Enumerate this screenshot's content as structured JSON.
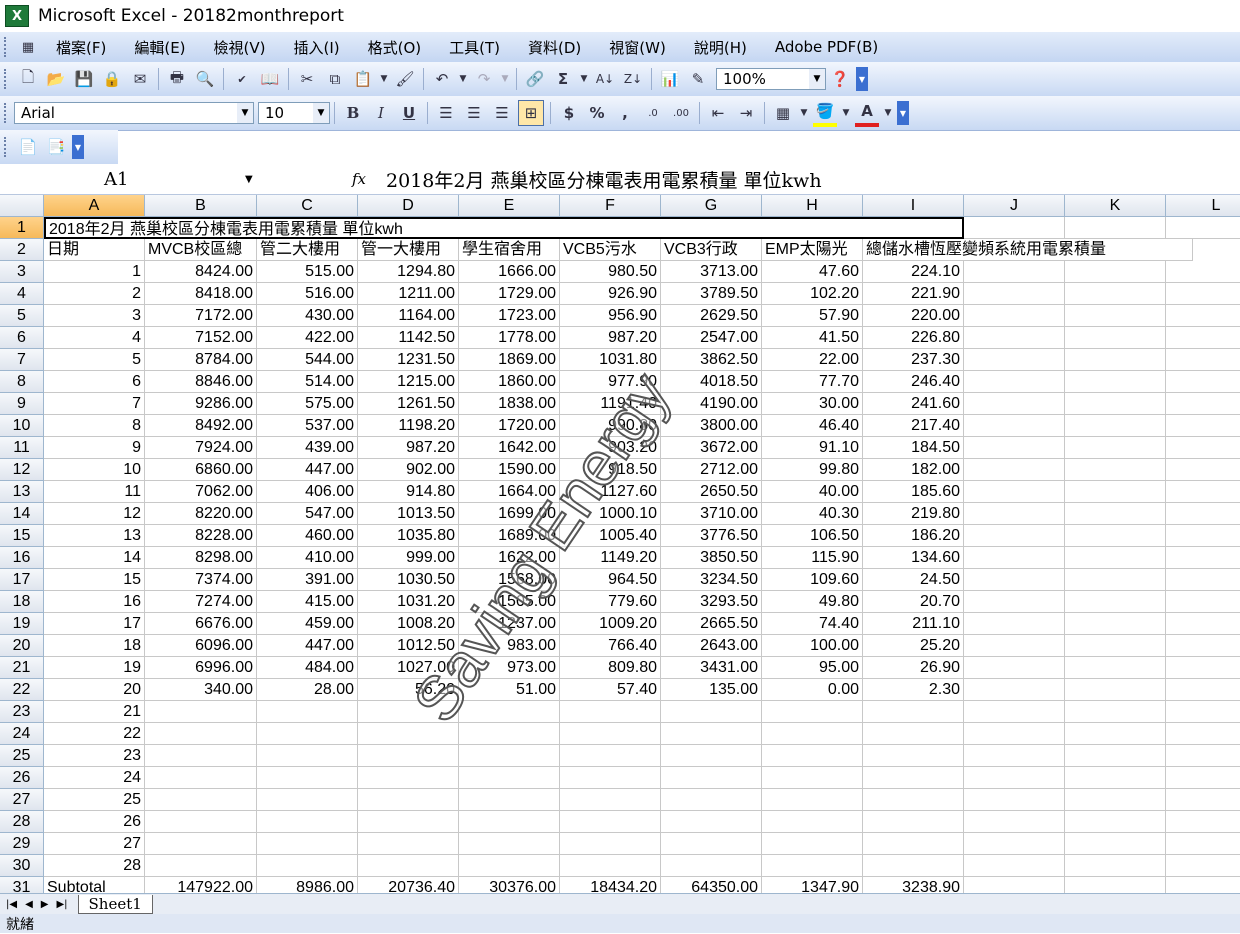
{
  "window": {
    "app_icon": "X",
    "title": "Microsoft Excel - 20182monthreport"
  },
  "menu": [
    "檔案(F)",
    "編輯(E)",
    "檢視(V)",
    "插入(I)",
    "格式(O)",
    "工具(T)",
    "資料(D)",
    "視窗(W)",
    "說明(H)",
    "Adobe PDF(B)"
  ],
  "toolbar": {
    "zoom": "100%"
  },
  "format_toolbar": {
    "font": "Arial",
    "size": "10"
  },
  "formula_bar": {
    "name_box": "A1",
    "fx": "fx",
    "content": "2018年2月 燕巢校區分棟電表用電累積量 單位kwh"
  },
  "columns": [
    "A",
    "B",
    "C",
    "D",
    "E",
    "F",
    "G",
    "H",
    "I",
    "J",
    "K",
    "L"
  ],
  "row1_title": "2018年2月 燕巢校區分棟電表用電累積量 單位kwh",
  "headers": [
    "日期",
    "MVCB校區總",
    "管二大樓用",
    "管一大樓用",
    "學生宿舍用",
    "VCB5污水",
    "VCB3行政",
    "EMP太陽光",
    "總儲水槽恆壓變頻系統用電累積量"
  ],
  "data_rows": [
    [
      "1",
      "8424.00",
      "515.00",
      "1294.80",
      "1666.00",
      "980.50",
      "3713.00",
      "47.60",
      "224.10"
    ],
    [
      "2",
      "8418.00",
      "516.00",
      "1211.00",
      "1729.00",
      "926.90",
      "3789.50",
      "102.20",
      "221.90"
    ],
    [
      "3",
      "7172.00",
      "430.00",
      "1164.00",
      "1723.00",
      "956.90",
      "2629.50",
      "57.90",
      "220.00"
    ],
    [
      "4",
      "7152.00",
      "422.00",
      "1142.50",
      "1778.00",
      "987.20",
      "2547.00",
      "41.50",
      "226.80"
    ],
    [
      "5",
      "8784.00",
      "544.00",
      "1231.50",
      "1869.00",
      "1031.80",
      "3862.50",
      "22.00",
      "237.30"
    ],
    [
      "6",
      "8846.00",
      "514.00",
      "1215.00",
      "1860.00",
      "977.90",
      "4018.50",
      "77.70",
      "246.40"
    ],
    [
      "7",
      "9286.00",
      "575.00",
      "1261.50",
      "1838.00",
      "1191.40",
      "4190.00",
      "30.00",
      "241.60"
    ],
    [
      "8",
      "8492.00",
      "537.00",
      "1198.20",
      "1720.00",
      "990.80",
      "3800.00",
      "46.40",
      "217.40"
    ],
    [
      "9",
      "7924.00",
      "439.00",
      "987.20",
      "1642.00",
      "903.20",
      "3672.00",
      "91.10",
      "184.50"
    ],
    [
      "10",
      "6860.00",
      "447.00",
      "902.00",
      "1590.00",
      "918.50",
      "2712.00",
      "99.80",
      "182.00"
    ],
    [
      "11",
      "7062.00",
      "406.00",
      "914.80",
      "1664.00",
      "1127.60",
      "2650.50",
      "40.00",
      "185.60"
    ],
    [
      "12",
      "8220.00",
      "547.00",
      "1013.50",
      "1699.00",
      "1000.10",
      "3710.00",
      "40.30",
      "219.80"
    ],
    [
      "13",
      "8228.00",
      "460.00",
      "1035.80",
      "1689.00",
      "1005.40",
      "3776.50",
      "106.50",
      "186.20"
    ],
    [
      "14",
      "8298.00",
      "410.00",
      "999.00",
      "1622.00",
      "1149.20",
      "3850.50",
      "115.90",
      "134.60"
    ],
    [
      "15",
      "7374.00",
      "391.00",
      "1030.50",
      "1568.00",
      "964.50",
      "3234.50",
      "109.60",
      "24.50"
    ],
    [
      "16",
      "7274.00",
      "415.00",
      "1031.20",
      "1505.00",
      "779.60",
      "3293.50",
      "49.80",
      "20.70"
    ],
    [
      "17",
      "6676.00",
      "459.00",
      "1008.20",
      "1237.00",
      "1009.20",
      "2665.50",
      "74.40",
      "211.10"
    ],
    [
      "18",
      "6096.00",
      "447.00",
      "1012.50",
      "983.00",
      "766.40",
      "2643.00",
      "100.00",
      "25.20"
    ],
    [
      "19",
      "6996.00",
      "484.00",
      "1027.00",
      "973.00",
      "809.80",
      "3431.00",
      "95.00",
      "26.90"
    ],
    [
      "20",
      "340.00",
      "28.00",
      "56.20",
      "51.00",
      "57.40",
      "135.00",
      "0.00",
      "2.30"
    ],
    [
      "21",
      "",
      "",
      "",
      "",
      "",
      "",
      "",
      ""
    ],
    [
      "22",
      "",
      "",
      "",
      "",
      "",
      "",
      "",
      ""
    ],
    [
      "23",
      "",
      "",
      "",
      "",
      "",
      "",
      "",
      ""
    ],
    [
      "24",
      "",
      "",
      "",
      "",
      "",
      "",
      "",
      ""
    ],
    [
      "25",
      "",
      "",
      "",
      "",
      "",
      "",
      "",
      ""
    ],
    [
      "26",
      "",
      "",
      "",
      "",
      "",
      "",
      "",
      ""
    ],
    [
      "27",
      "",
      "",
      "",
      "",
      "",
      "",
      "",
      ""
    ],
    [
      "28",
      "",
      "",
      "",
      "",
      "",
      "",
      "",
      ""
    ]
  ],
  "subtotal": [
    "Subtotal",
    "147922.00",
    "8986.00",
    "20736.40",
    "30376.00",
    "18434.20",
    "64350.00",
    "1347.90",
    "3238.90"
  ],
  "sheet_tab": "Sheet1",
  "status": "就緒",
  "watermark": "Saving Energy"
}
